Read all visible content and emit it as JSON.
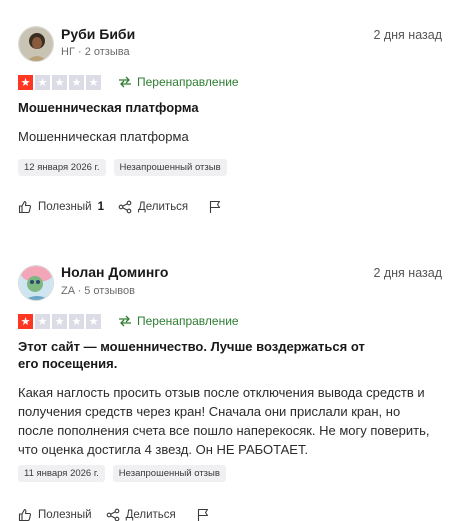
{
  "reviews": [
    {
      "author": "Руби Биби",
      "country": "НГ",
      "review_count": "2 отзыва",
      "date": "2 дня назад",
      "rating": 1,
      "redirect_label": "Перенаправление",
      "title": "Мошенническая платформа",
      "body": "Мошенническая платформа",
      "experience_date": "12 января 2026 г.",
      "badge": "Незапрошенный отзыв",
      "helpful_label": "Полезный",
      "helpful_count": "1",
      "share_label": "Делиться"
    },
    {
      "author": "Нолан Доминго",
      "country": "ZA",
      "review_count": "5 отзывов",
      "date": "2 дня назад",
      "rating": 1,
      "redirect_label": "Перенаправление",
      "title": "Этот сайт — мошенничество. Лучше воздержаться от его посещения.",
      "body": "Какая наглость просить отзыв после отключения вывода средств и получения средств через кран! Сначала они прислали кран, но после пополнения счета все пошло наперекосяк. Не могу поверить, что оценка достигла 4 звезд. Он НЕ РАБОТАЕТ.",
      "experience_date": "11 января 2026 г.",
      "badge": "Незапрошенный отзыв",
      "helpful_label": "Полезный",
      "helpful_count": "",
      "share_label": "Делиться"
    }
  ],
  "colors": {
    "star_filled": "#ff3722",
    "star_empty": "#dcdce6",
    "redirect": "#2e7d32"
  },
  "icons": [
    "redirect-arrow-icon",
    "thumbs-up-icon",
    "share-icon",
    "flag-icon"
  ]
}
